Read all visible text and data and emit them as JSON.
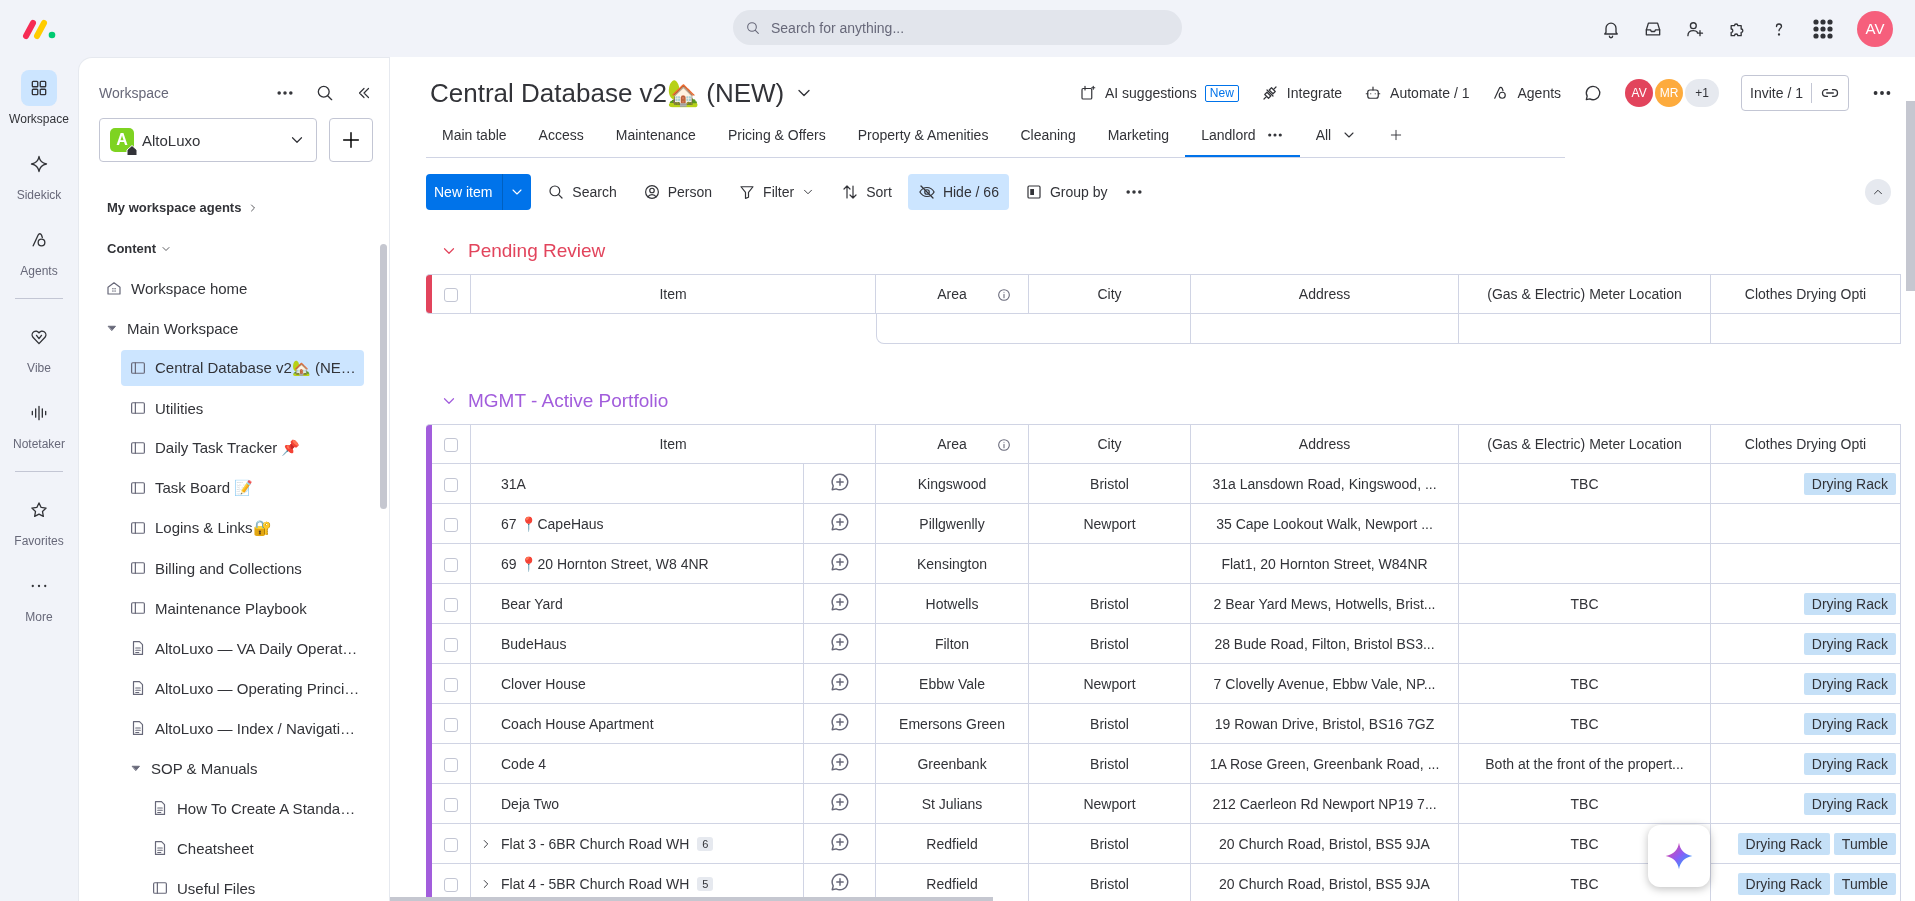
{
  "topbar": {
    "search_placeholder": "Search for anything...",
    "avatar": "AV"
  },
  "rail": [
    {
      "label": "Workspace",
      "kind": "workspace",
      "selected": true
    },
    {
      "label": "Sidekick",
      "kind": "sidekick",
      "selected": false
    },
    {
      "label": "Agents",
      "kind": "agents",
      "selected": false
    },
    {
      "label": "Vibe",
      "kind": "vibe",
      "selected": false
    },
    {
      "label": "Notetaker",
      "kind": "notetaker",
      "selected": false
    },
    {
      "label": "Favorites",
      "kind": "favorites",
      "selected": false
    },
    {
      "label": "More",
      "kind": "more",
      "selected": false
    }
  ],
  "sidebar": {
    "title": "Workspace",
    "workspace_badge": "A",
    "workspace_name": "AltoLuxo",
    "agents_link": "My workspace agents",
    "content_label": "Content",
    "items": [
      {
        "label": "Workspace home",
        "kind": "home",
        "selected": false
      },
      {
        "label": "Main Workspace",
        "kind": "folder",
        "expanded": true,
        "selected": false,
        "children": [
          {
            "label": "Central Database v2🏡 (NE…",
            "kind": "board",
            "selected": true
          },
          {
            "label": "Utilities",
            "kind": "board",
            "selected": false
          },
          {
            "label": "Daily Task Tracker 📌",
            "kind": "board",
            "selected": false
          },
          {
            "label": "Task Board 📝",
            "kind": "board",
            "selected": false
          },
          {
            "label": "Logins & Links🔐",
            "kind": "board",
            "selected": false
          },
          {
            "label": "Billing and Collections",
            "kind": "board",
            "selected": false
          },
          {
            "label": "Maintenance Playbook",
            "kind": "board",
            "selected": false
          },
          {
            "label": "AltoLuxo — VA Daily Operat…",
            "kind": "doc",
            "selected": false
          },
          {
            "label": "AltoLuxo — Operating Princi…",
            "kind": "doc",
            "selected": false
          },
          {
            "label": "AltoLuxo — Index / Navigati…",
            "kind": "doc",
            "selected": false
          },
          {
            "label": "SOP & Manuals",
            "kind": "folder",
            "expanded": true,
            "selected": false,
            "children": [
              {
                "label": "How To Create A Standa…",
                "kind": "doc",
                "selected": false
              },
              {
                "label": "Cheatsheet",
                "kind": "doc",
                "selected": false
              },
              {
                "label": "Useful Files",
                "kind": "board",
                "selected": false
              }
            ]
          }
        ]
      }
    ]
  },
  "board": {
    "title": "Central Database v2🏡 (NEW)",
    "actions": [
      {
        "label": "AI suggestions",
        "kind": "ai",
        "badge": "New"
      },
      {
        "label": "Integrate",
        "kind": "integrate"
      },
      {
        "label": "Automate / 1",
        "kind": "automate"
      },
      {
        "label": "Agents",
        "kind": "agents"
      }
    ],
    "members": [
      "AV",
      "MR"
    ],
    "members_more": "+1",
    "invite": "Invite / 1",
    "views": [
      {
        "label": "Main table",
        "selected": false
      },
      {
        "label": "Access",
        "selected": false
      },
      {
        "label": "Maintenance",
        "selected": false
      },
      {
        "label": "Pricing & Offers",
        "selected": false
      },
      {
        "label": "Property & Amenities",
        "selected": false
      },
      {
        "label": "Cleaning",
        "selected": false
      },
      {
        "label": "Marketing",
        "selected": false
      },
      {
        "label": "Landlord",
        "selected": true
      }
    ],
    "views_all": "All",
    "toolbar": {
      "new_item": "New item",
      "search": "Search",
      "person": "Person",
      "filter": "Filter",
      "sort": "Sort",
      "hide": "Hide / 66",
      "group_by": "Group by"
    }
  },
  "groups": [
    {
      "title": "Pending Review",
      "color": "#e2445c",
      "all_checked": false,
      "columns": [
        "Item",
        "Area",
        "City",
        "Address",
        "(Gas & Electric) Meter Location",
        "Clothes Drying Opti"
      ]
    },
    {
      "title": "MGMT - Active Portfolio",
      "color": "#a25ddc",
      "all_checked": false,
      "columns": [
        "Item",
        "Area",
        "City",
        "Address",
        "(Gas & Electric) Meter Location",
        "Clothes Drying Opti"
      ],
      "rows": [
        {
          "item": "31A",
          "checked": false,
          "area": "Kingswood",
          "city": "Bristol",
          "address": "31a Lansdown Road, Kingswood, ...",
          "meter": "TBC",
          "tags": [
            "Drying Rack"
          ]
        },
        {
          "item": "67 📍CapeHaus",
          "checked": false,
          "area": "Pillgwenlly",
          "city": "Newport",
          "address": "35 Cape Lookout Walk, Newport ...",
          "meter": "",
          "tags": []
        },
        {
          "item": "69 📍20 Hornton Street, W8 4NR",
          "checked": false,
          "area": "Kensington",
          "city": "",
          "address": "Flat1, 20 Hornton Street, W84NR",
          "meter": "",
          "tags": []
        },
        {
          "item": "Bear Yard",
          "checked": false,
          "area": "Hotwells",
          "city": "Bristol",
          "address": "2 Bear Yard Mews, Hotwells, Brist...",
          "meter": "TBC",
          "tags": [
            "Drying Rack"
          ]
        },
        {
          "item": "BudeHaus",
          "checked": false,
          "area": "Filton",
          "city": "Bristol",
          "address": "28 Bude Road, Filton, Bristol BS3...",
          "meter": "",
          "tags": [
            "Drying Rack"
          ]
        },
        {
          "item": "Clover House",
          "checked": false,
          "area": "Ebbw Vale",
          "city": "Newport",
          "address": "7 Clovelly Avenue, Ebbw Vale, NP...",
          "meter": "TBC",
          "tags": [
            "Drying Rack"
          ]
        },
        {
          "item": "Coach House Apartment",
          "checked": false,
          "area": "Emersons Green",
          "city": "Bristol",
          "address": "19 Rowan Drive, Bristol, BS16 7GZ",
          "meter": "TBC",
          "tags": [
            "Drying Rack"
          ]
        },
        {
          "item": "Code 4",
          "checked": false,
          "area": "Greenbank",
          "city": "Bristol",
          "address": "1A Rose Green, Greenbank Road, ...",
          "meter": "Both at the front of the propert...",
          "tags": [
            "Drying Rack"
          ]
        },
        {
          "item": "Deja Two",
          "checked": false,
          "area": "St Julians",
          "city": "Newport",
          "address": "212 Caerleon Rd Newport NP19 7...",
          "meter": "TBC",
          "tags": [
            "Drying Rack"
          ]
        },
        {
          "item": "Flat 3 - 6BR Church Road WH",
          "subitems": "6",
          "checked": false,
          "area": "Redfield",
          "city": "Bristol",
          "address": "20 Church Road, Bristol, BS5 9JA",
          "meter": "TBC",
          "tags": [
            "Drying Rack",
            "Tumble"
          ]
        },
        {
          "item": "Flat 4 - 5BR Church Road WH",
          "subitems": "5",
          "checked": false,
          "area": "Redfield",
          "city": "Bristol",
          "address": "20 Church Road, Bristol, BS5 9JA",
          "meter": "TBC",
          "tags": [
            "Drying Rack",
            "Tumble"
          ]
        }
      ]
    }
  ]
}
